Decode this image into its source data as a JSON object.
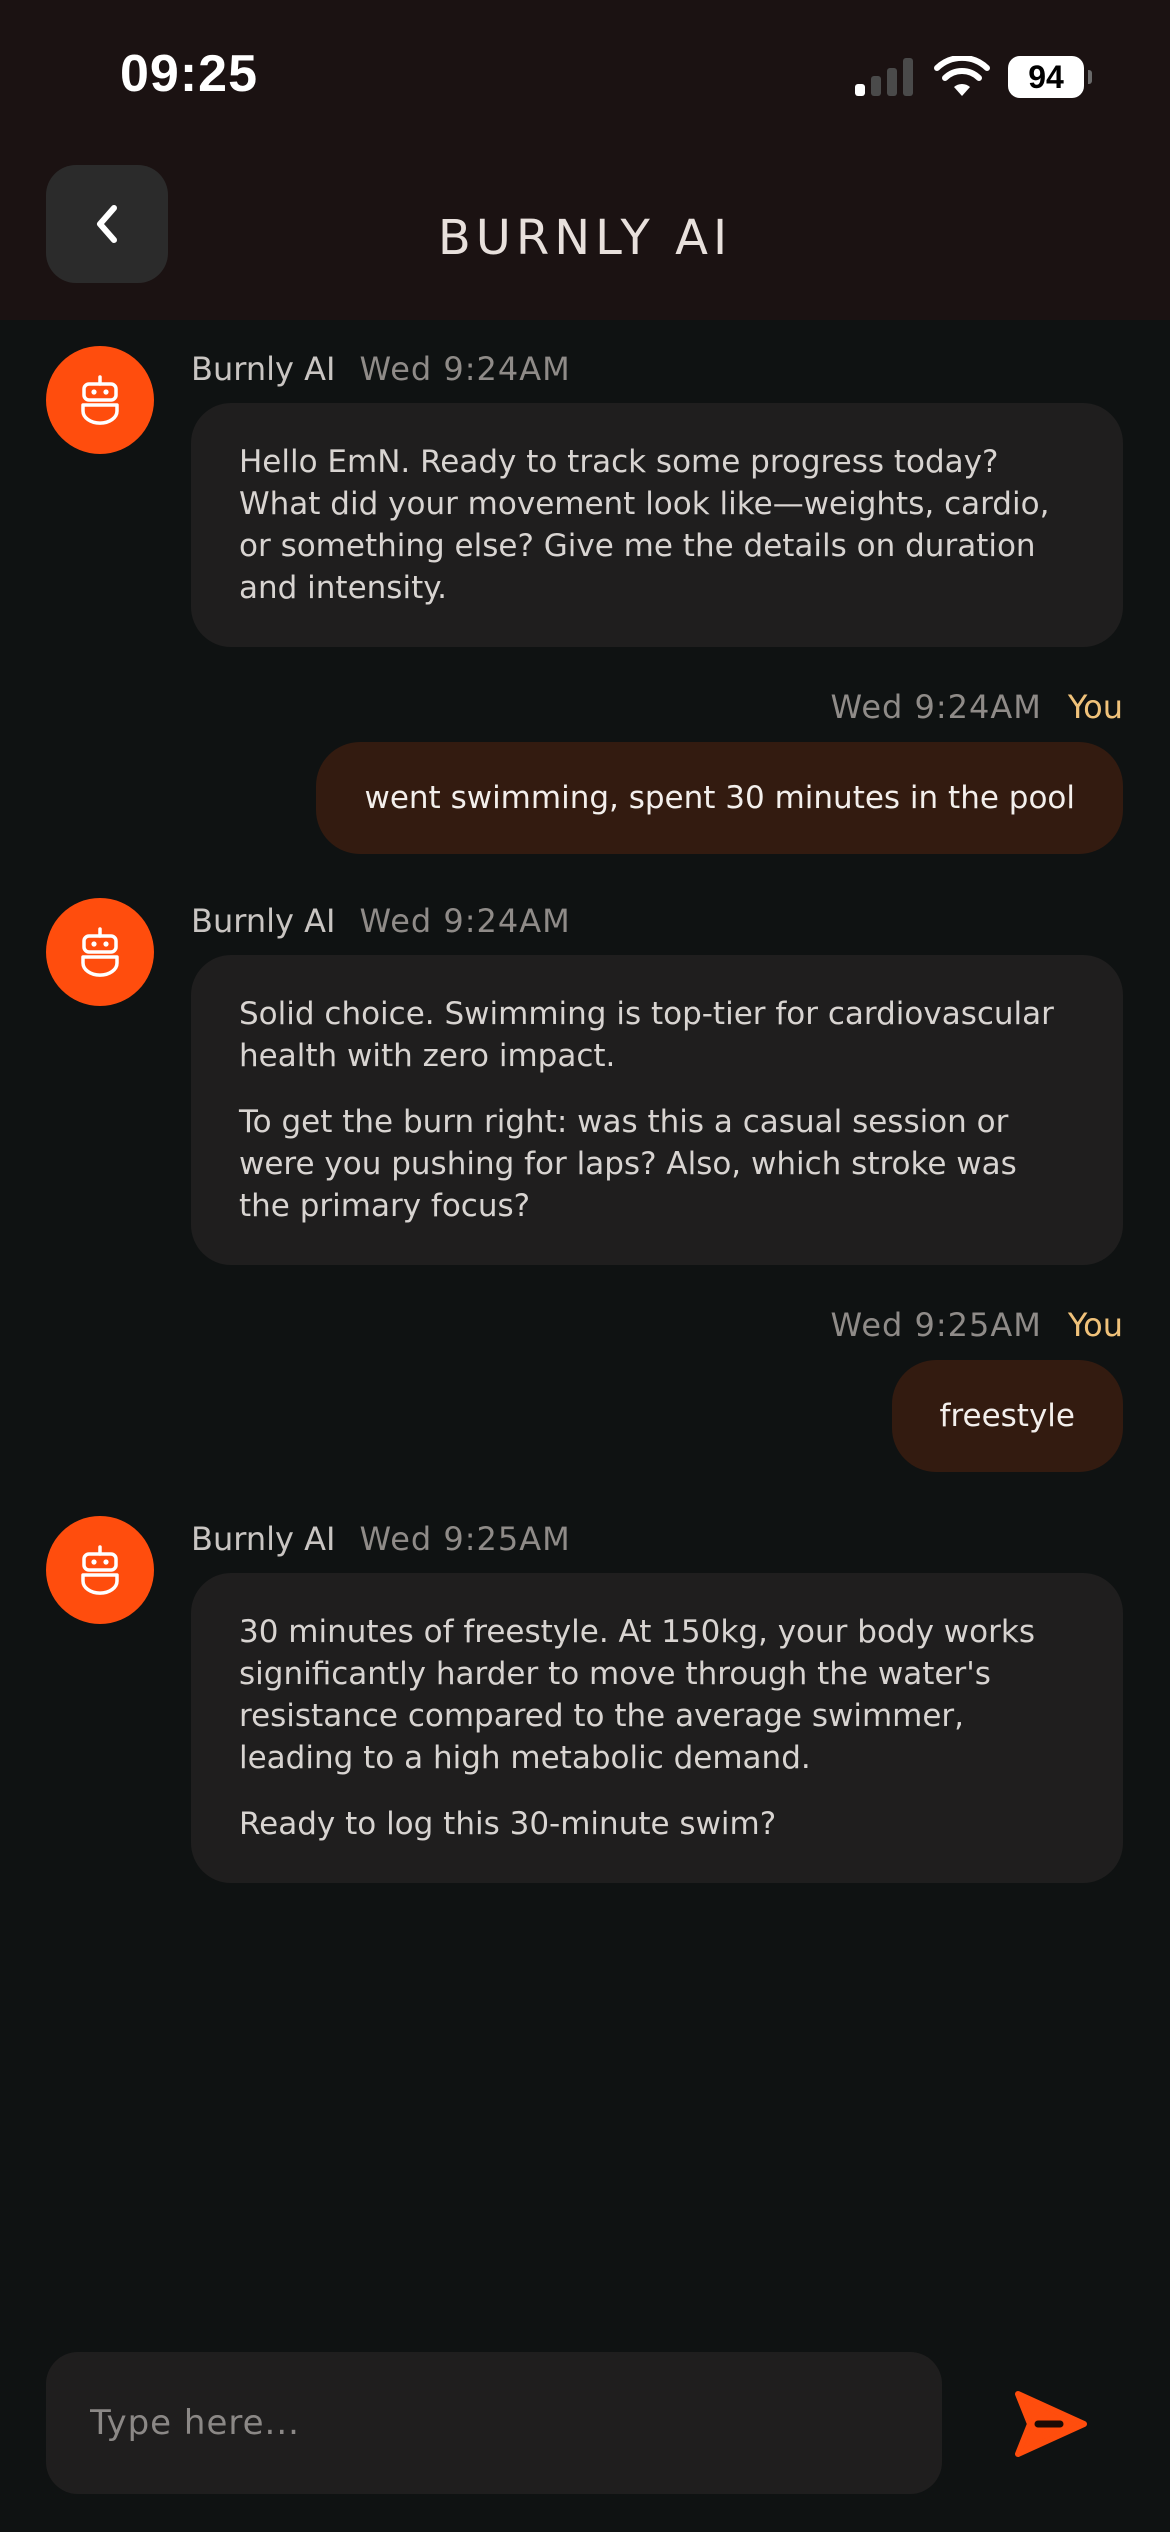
{
  "status": {
    "time": "09:25",
    "battery": "94"
  },
  "header": {
    "title": "BURNLY AI"
  },
  "messages": [
    {
      "role": "ai",
      "sender": "Burnly AI",
      "time": "Wed 9:24AM",
      "paragraphs": [
        "Hello EmN. Ready to track some progress today? What did your movement look like—weights, cardio, or something else? Give me the details on duration and intensity."
      ]
    },
    {
      "role": "user",
      "sender": "You",
      "time": "Wed 9:24AM",
      "text": "went swimming, spent 30 minutes in the pool"
    },
    {
      "role": "ai",
      "sender": "Burnly AI",
      "time": "Wed 9:24AM",
      "paragraphs": [
        "Solid choice. Swimming is top-tier for cardiovascular health with zero impact.",
        "To get the burn right: was this a casual session or were you pushing for laps? Also, which stroke was the primary focus?"
      ]
    },
    {
      "role": "user",
      "sender": "You",
      "time": "Wed 9:25AM",
      "text": "freestyle"
    },
    {
      "role": "ai",
      "sender": "Burnly AI",
      "time": "Wed 9:25AM",
      "paragraphs": [
        "30 minutes of freestyle. At 150kg, your body works significantly harder to move through the water's resistance compared to the average swimmer, leading to a high metabolic demand.",
        "Ready to log this 30-minute swim?"
      ]
    }
  ],
  "composer": {
    "placeholder": "Type here..."
  },
  "colors": {
    "accent": "#ff4d0d",
    "you_label": "#f0c27a",
    "user_bubble": "#331b10",
    "ai_bubble": "#1f1e1e",
    "background": "#0f1212",
    "header_bg": "#1b1212"
  },
  "icons": {
    "back": "chevron-left-icon",
    "avatar": "robot-icon",
    "send": "send-icon"
  }
}
